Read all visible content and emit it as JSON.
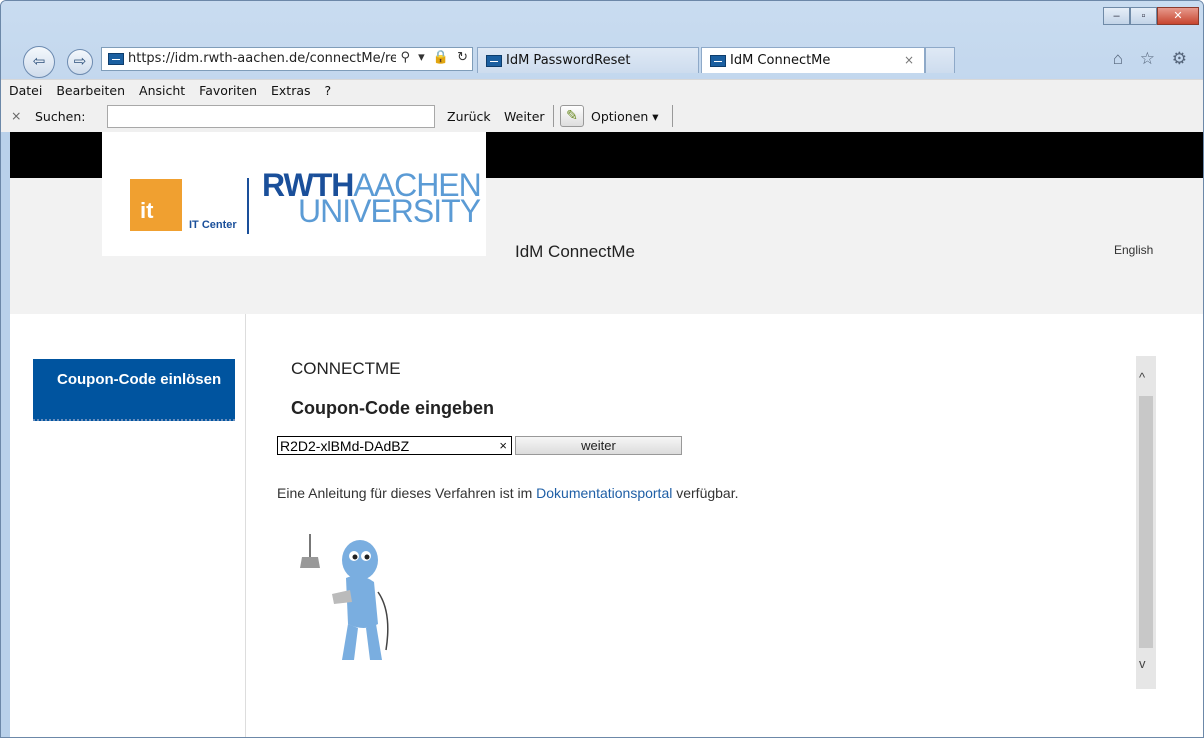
{
  "browser": {
    "window_controls": {
      "minimize": "–",
      "maximize": "▫",
      "close": "✕"
    },
    "nav": {
      "back_icon": "back-arrow-icon",
      "forward_icon": "forward-arrow-icon"
    },
    "address": {
      "url": "https://idm.rwth-aachen.de/connectMe/red",
      "icons": "⚲ ▾ 🔒 ↻"
    },
    "tabs": [
      {
        "label": "IdM PasswordReset"
      },
      {
        "label": "IdM ConnectMe",
        "close": "×"
      }
    ],
    "right_icons": "⌂ ☆ ⚙"
  },
  "menu": [
    "Datei",
    "Bearbeiten",
    "Ansicht",
    "Favoriten",
    "Extras",
    "?"
  ],
  "findbar": {
    "close": "×",
    "label": "Suchen:",
    "back": "Zurück",
    "forward": "Weiter",
    "options": "Optionen ▾"
  },
  "header": {
    "it_logo": "it",
    "it_center": "IT Center",
    "rwth_line1a": "RWTH",
    "rwth_line1b": "AACHEN",
    "rwth_line2": "UNIVERSITY",
    "site_name": "IdM ConnectMe",
    "language": "English"
  },
  "sidebar": {
    "item": "Coupon-Code einlösen"
  },
  "main": {
    "title": "CONNECTME",
    "subtitle": "Coupon-Code eingeben",
    "code_value": "R2D2-xlBMd-DAdBZ",
    "clear": "×",
    "submit": "weiter",
    "info_pre": "Eine Anleitung für dieses Verfahren ist im ",
    "info_link": "Dokumentationsportal",
    "info_post": " verfügbar.",
    "scroll_up": "^",
    "scroll_down": "v"
  },
  "colors": {
    "brand_blue": "#00549f",
    "it_orange": "#f0a030",
    "link": "#1f5fa6"
  }
}
